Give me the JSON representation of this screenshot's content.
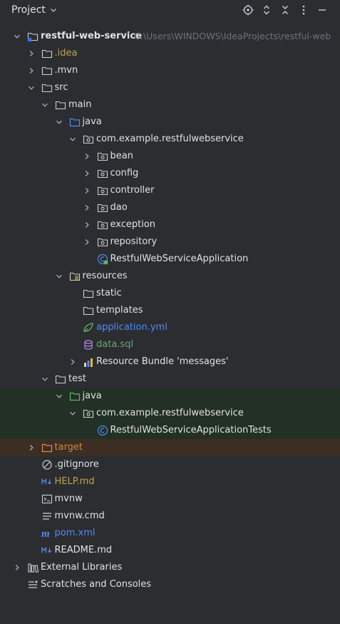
{
  "header": {
    "title": "Project",
    "icons": [
      "locate-icon",
      "expand-collapse-icon",
      "collapse-all-icon",
      "more-icon",
      "minimize-icon"
    ]
  },
  "tree": [
    {
      "name": "root",
      "depth": 0,
      "arrow": "down",
      "icon": "module-folder",
      "label": "restful-web-service",
      "extra": "C:\\Users\\WINDOWS\\IdeaProjects\\restful-web",
      "bold": true
    },
    {
      "name": "idea",
      "depth": 1,
      "arrow": "right",
      "icon": "folder",
      "label": ".idea",
      "color": "yellow"
    },
    {
      "name": "mvn",
      "depth": 1,
      "arrow": "right",
      "icon": "folder",
      "label": ".mvn"
    },
    {
      "name": "src",
      "depth": 1,
      "arrow": "down",
      "icon": "folder",
      "label": "src"
    },
    {
      "name": "main",
      "depth": 2,
      "arrow": "down",
      "icon": "folder",
      "label": "main"
    },
    {
      "name": "java",
      "depth": 3,
      "arrow": "down",
      "icon": "source-folder",
      "label": "java"
    },
    {
      "name": "package-main",
      "depth": 4,
      "arrow": "down",
      "icon": "package",
      "label": "com.example.restfulwebservice"
    },
    {
      "name": "bean",
      "depth": 5,
      "arrow": "right",
      "icon": "package",
      "label": "bean"
    },
    {
      "name": "config",
      "depth": 5,
      "arrow": "right",
      "icon": "package",
      "label": "config"
    },
    {
      "name": "controller",
      "depth": 5,
      "arrow": "right",
      "icon": "package",
      "label": "controller"
    },
    {
      "name": "dao",
      "depth": 5,
      "arrow": "right",
      "icon": "package",
      "label": "dao"
    },
    {
      "name": "exception",
      "depth": 5,
      "arrow": "right",
      "icon": "package",
      "label": "exception"
    },
    {
      "name": "repository",
      "depth": 5,
      "arrow": "right",
      "icon": "package",
      "label": "repository"
    },
    {
      "name": "app-class",
      "depth": 5,
      "arrow": "",
      "icon": "spring-class",
      "label": "RestfulWebServiceApplication"
    },
    {
      "name": "resources",
      "depth": 3,
      "arrow": "down",
      "icon": "resources-folder",
      "label": "resources"
    },
    {
      "name": "static",
      "depth": 4,
      "arrow": "",
      "icon": "folder",
      "label": "static"
    },
    {
      "name": "templates",
      "depth": 4,
      "arrow": "",
      "icon": "folder",
      "label": "templates"
    },
    {
      "name": "application-yml",
      "depth": 4,
      "arrow": "",
      "icon": "spring-yml",
      "label": "application.yml",
      "color": "blue"
    },
    {
      "name": "data-sql",
      "depth": 4,
      "arrow": "",
      "icon": "sql-file",
      "label": "data.sql",
      "color": "green-text"
    },
    {
      "name": "resource-bundle",
      "depth": 4,
      "arrow": "right",
      "icon": "resource-bundle",
      "label": "Resource Bundle 'messages'"
    },
    {
      "name": "test",
      "depth": 2,
      "arrow": "down",
      "icon": "folder",
      "label": "test"
    },
    {
      "name": "test-java",
      "depth": 3,
      "arrow": "down",
      "icon": "test-folder",
      "label": "java",
      "row": "green"
    },
    {
      "name": "package-test",
      "depth": 4,
      "arrow": "down",
      "icon": "package",
      "label": "com.example.restfulwebservice",
      "row": "green"
    },
    {
      "name": "test-class",
      "depth": 5,
      "arrow": "",
      "icon": "class",
      "label": "RestfulWebServiceApplicationTests",
      "row": "green"
    },
    {
      "name": "target",
      "depth": 1,
      "arrow": "right",
      "icon": "excluded-folder",
      "label": "target",
      "color": "orange",
      "row": "orange"
    },
    {
      "name": "gitignore",
      "depth": 1,
      "arrow": "",
      "icon": "ignore-file",
      "label": ".gitignore"
    },
    {
      "name": "help-md",
      "depth": 1,
      "arrow": "",
      "icon": "markdown",
      "label": "HELP.md",
      "color": "yellow"
    },
    {
      "name": "mvnw",
      "depth": 1,
      "arrow": "",
      "icon": "terminal",
      "label": "mvnw"
    },
    {
      "name": "mvnw-cmd",
      "depth": 1,
      "arrow": "",
      "icon": "text-file",
      "label": "mvnw.cmd"
    },
    {
      "name": "pom-xml",
      "depth": 1,
      "arrow": "",
      "icon": "maven",
      "label": "pom.xml",
      "color": "blue"
    },
    {
      "name": "readme-md",
      "depth": 1,
      "arrow": "",
      "icon": "markdown",
      "label": "README.md"
    },
    {
      "name": "external-libraries",
      "depth": 0,
      "arrow": "right",
      "icon": "libraries",
      "label": "External Libraries"
    },
    {
      "name": "scratches",
      "depth": 0,
      "arrow": "",
      "icon": "scratches",
      "label": "Scratches and Consoles"
    }
  ]
}
